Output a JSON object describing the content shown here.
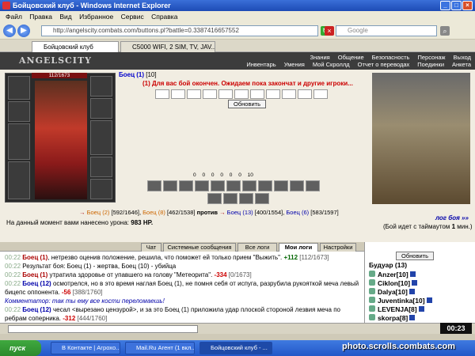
{
  "window": {
    "title": "Бойцовский клуб - Windows Internet Explorer"
  },
  "menu": [
    "Файл",
    "Правка",
    "Вид",
    "Избранное",
    "Сервис",
    "Справка"
  ],
  "address": {
    "url": "http://angelscity.combats.com/buttons.pl?battle=0.3387416657552",
    "search_placeholder": "Google"
  },
  "browser_tabs": [
    {
      "label": "Бойцовский клуб",
      "active": true
    },
    {
      "label": "C5000 WIFI, 2 SIM, TV, JAV...",
      "active": false
    }
  ],
  "game": {
    "logo": "ANGELSCITY",
    "nav_top": [
      "Знания",
      "Общение",
      "Безопасность",
      "Персонаж",
      "Выход"
    ],
    "nav_bottom": [
      "Инвентарь",
      "Умения",
      "Мой Скроллд",
      "Отчет о переводах",
      "Поединки",
      "Анкета"
    ],
    "hp": "112/1673",
    "player_name": "Боец (1)",
    "player_level": "[10]",
    "battle_message": "(1) Для вас бой окончен. Ожидаем пока закончат и другие игроки...",
    "refresh_label": "Обновить",
    "stats": [
      "0",
      "0",
      "0",
      "0",
      "0",
      "0",
      "10"
    ],
    "teams": {
      "left": [
        {
          "name": "Боец (2)",
          "hp": "[592/1646]"
        },
        {
          "name": "Боец (8)",
          "hp": "[462/1538]"
        }
      ],
      "vs": "против",
      "right": [
        {
          "name": "Боец (13)",
          "hp": "[400/1554]"
        },
        {
          "name": "Боец (6)",
          "hp": "[583/1597]"
        }
      ]
    },
    "damage_text": "На данный момент вами нанесено урона:",
    "damage_value": "983 HP.",
    "battle_log_link": "лог боя »»",
    "timeout_text": "(Бой идет с таймаутом",
    "timeout_value": "1",
    "timeout_unit": "мин.)"
  },
  "chat_tabs": [
    "Чат",
    "Системные сообщения",
    "Все логи",
    "Мои логи",
    "Настройки"
  ],
  "chat_active_tab": "Мои логи",
  "chat_lines": [
    {
      "time": "00:22",
      "name": "Боец (1)",
      "text": ", нетрезво оценив положение, решила, что поможет ей только прием \"Выжить\".",
      "extra": "+112",
      "extra2": "[112/1673]"
    },
    {
      "time": "00:22",
      "name": "",
      "text": "Результат боя: Боец (1) - жертва, Боец (10) - убийца",
      "extra": "",
      "extra2": ""
    },
    {
      "time": "00:22",
      "name": "Боец (1)",
      "text": "утратила здоровье от упавшего на голову \"Метеорита\".",
      "extra": "-334",
      "extra2": "[0/1673]"
    },
    {
      "time": "00:22",
      "name": "Боец (12)",
      "text": "осмотрелся, но в это время наглая Боец (1), не помня себя от испуга, разрубила рукояткой меча левый бицепс оппонента.",
      "extra": "-56",
      "extra2": "[388/1760]"
    },
    {
      "time": "",
      "name": "",
      "text": "Комментатор: так ты ему все кости переломаешь!",
      "extra": "",
      "extra2": ""
    },
    {
      "time": "00:22",
      "name": "Боец (12)",
      "text": "чесал <вырезано цензурой>, и за это Боец (1) приложила удар плоской стороной лезвия меча по ребрам соперника.",
      "extra": "-312",
      "extra2": "[444/1760]"
    }
  ],
  "sidebar": {
    "refresh_label": "Обновить",
    "location": "Будуар (13)",
    "players": [
      "Anzer[10]",
      "Ciklon[10]",
      "Dalya[10]",
      "Juventinka[10]",
      "LEVENJA[8]",
      "skorpa[8]"
    ]
  },
  "clock": "00:23",
  "taskbar": {
    "start_label": "пуск",
    "items": [
      "В Контакте | Агрохо...",
      "Mail.Ru Агент (1 вкл...",
      "Бойцовский клуб - ..."
    ],
    "active_index": 2
  },
  "watermark": "photo.scrolls.combats.com"
}
